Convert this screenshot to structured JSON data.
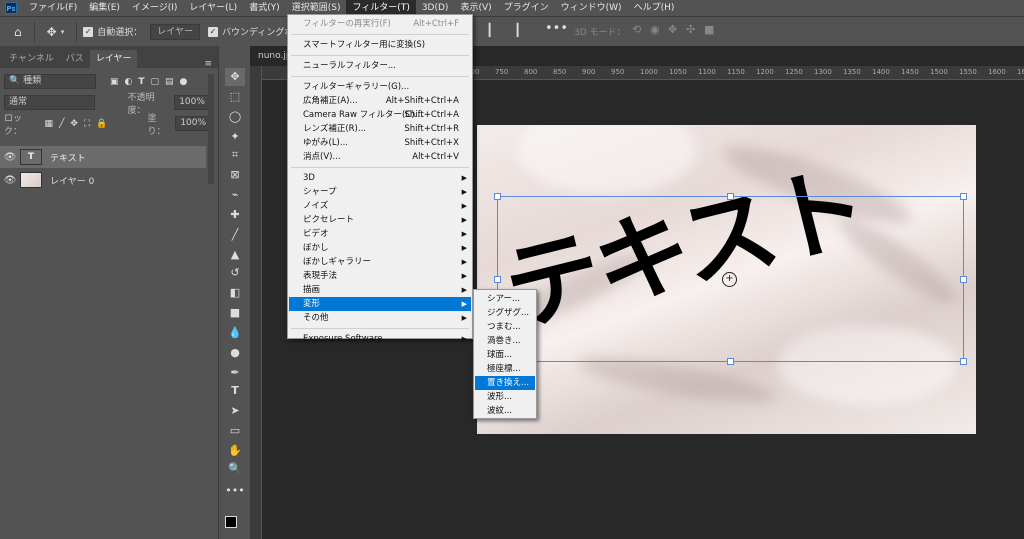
{
  "menubar": {
    "items": [
      "ファイル(F)",
      "編集(E)",
      "イメージ(I)",
      "レイヤー(L)",
      "書式(Y)",
      "選択範囲(S)",
      "フィルター(T)",
      "3D(D)",
      "表示(V)",
      "プラグイン",
      "ウィンドウ(W)",
      "ヘルプ(H)"
    ]
  },
  "options": {
    "auto_select_label": "自動選択：",
    "auto_select_value": "レイヤー",
    "bounding_label": "バウンディングボ",
    "mode_3d_label": "3D モード："
  },
  "panel": {
    "tabs": [
      "チャンネル",
      "パス",
      "レイヤー"
    ],
    "kind_filter": "種類",
    "blend_mode": "通常",
    "opacity_label": "不透明度：",
    "opacity_value": "100%",
    "lock_label": "ロック：",
    "fill_label": "塗り：",
    "fill_value": "100%",
    "layers": [
      {
        "name": "テキスト",
        "type": "text",
        "selected": true
      },
      {
        "name": "レイヤー 0",
        "type": "image",
        "selected": false
      }
    ]
  },
  "document": {
    "tab_title": "nuno.jp",
    "ruler_ticks": [
      "700",
      "750",
      "800",
      "850",
      "900",
      "950",
      "1000",
      "1050",
      "1100",
      "1150",
      "1200",
      "1250",
      "1300",
      "1350",
      "1400",
      "1450",
      "1500",
      "1550",
      "1600",
      "1650"
    ],
    "canvas_text": "テキスト"
  },
  "filter_menu": {
    "items": [
      {
        "label": "フィルターの再実行(F)",
        "shortcut": "Alt+Ctrl+F",
        "disabled": true
      },
      {
        "label": "スマートフィルター用に変換(S)",
        "shortcut": ""
      },
      {
        "label": "ニューラルフィルター...",
        "shortcut": ""
      },
      {
        "label": "フィルターギャラリー(G)...",
        "shortcut": ""
      },
      {
        "label": "広角補正(A)...",
        "shortcut": "Alt+Shift+Ctrl+A"
      },
      {
        "label": "Camera Raw フィルター(C)...",
        "shortcut": "Shift+Ctrl+A"
      },
      {
        "label": "レンズ補正(R)...",
        "shortcut": "Shift+Ctrl+R"
      },
      {
        "label": "ゆがみ(L)...",
        "shortcut": "Shift+Ctrl+X"
      },
      {
        "label": "消点(V)...",
        "shortcut": "Alt+Ctrl+V"
      },
      {
        "label": "3D",
        "submenu": true
      },
      {
        "label": "シャープ",
        "submenu": true
      },
      {
        "label": "ノイズ",
        "submenu": true
      },
      {
        "label": "ピクセレート",
        "submenu": true
      },
      {
        "label": "ビデオ",
        "submenu": true
      },
      {
        "label": "ぼかし",
        "submenu": true
      },
      {
        "label": "ぼかしギャラリー",
        "submenu": true
      },
      {
        "label": "表現手法",
        "submenu": true
      },
      {
        "label": "描画",
        "submenu": true
      },
      {
        "label": "変形",
        "submenu": true,
        "highlighted": true
      },
      {
        "label": "その他",
        "submenu": true
      },
      {
        "label": "Exposure Software",
        "submenu": true
      }
    ]
  },
  "distort_submenu": {
    "items": [
      "シアー...",
      "ジグザグ...",
      "つまむ...",
      "渦巻き...",
      "球面...",
      "極座標...",
      "置き換え...",
      "波形...",
      "波紋..."
    ],
    "highlighted": "置き換え..."
  }
}
